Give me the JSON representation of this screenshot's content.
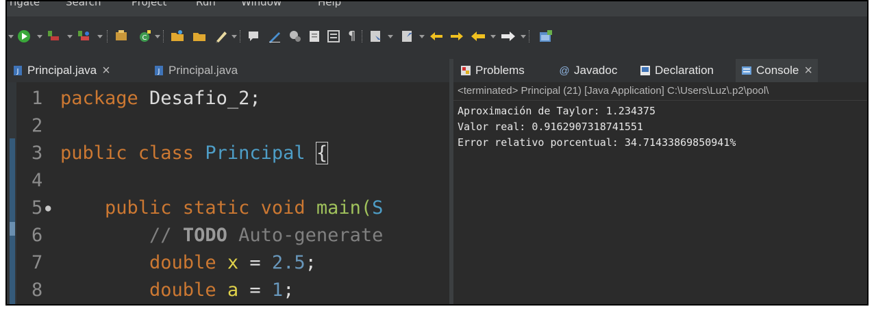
{
  "menubar": {
    "items": [
      "rigate",
      "Search",
      "Project",
      "Run",
      "Window",
      "Help"
    ]
  },
  "editor": {
    "tabs": [
      {
        "label": "Principal.java",
        "active": true,
        "close": "×"
      },
      {
        "label": "Principal.java",
        "active": false
      }
    ],
    "lines": [
      {
        "n": "1",
        "parts": [
          {
            "t": "package ",
            "c": "kw"
          },
          {
            "t": "Desafio_2;",
            "c": ""
          }
        ]
      },
      {
        "n": "2",
        "parts": []
      },
      {
        "n": "3",
        "parts": [
          {
            "t": "public class ",
            "c": "kw"
          },
          {
            "t": "Principal",
            "c": "cls"
          },
          {
            "t": " ",
            "c": ""
          }
        ],
        "brace": "{"
      },
      {
        "n": "4",
        "parts": []
      },
      {
        "n": "5",
        "marker": "●",
        "parts": [
          {
            "t": "    public static void ",
            "c": "kw"
          },
          {
            "t": "main(",
            "c": "fn"
          },
          {
            "t": "S",
            "c": "cls"
          }
        ]
      },
      {
        "n": "6",
        "parts": [
          {
            "t": "        // ",
            "c": "cmt"
          },
          {
            "t": "TODO",
            "c": "todo"
          },
          {
            "t": " Auto-generate",
            "c": "cmt"
          }
        ]
      },
      {
        "n": "7",
        "parts": [
          {
            "t": "        double ",
            "c": "kw"
          },
          {
            "t": "x",
            "c": "fld"
          },
          {
            "t": " = ",
            "c": ""
          },
          {
            "t": "2.5",
            "c": "num"
          },
          {
            "t": ";",
            "c": ""
          }
        ]
      },
      {
        "n": "8",
        "parts": [
          {
            "t": "        double ",
            "c": "kw"
          },
          {
            "t": "a",
            "c": "fld"
          },
          {
            "t": " = ",
            "c": ""
          },
          {
            "t": "1",
            "c": "num"
          },
          {
            "t": ";",
            "c": ""
          }
        ]
      }
    ]
  },
  "views": {
    "tabs": [
      {
        "label": "Problems",
        "icon": "problems-icon"
      },
      {
        "label": "Javadoc",
        "icon": "javadoc-icon"
      },
      {
        "label": "Declaration",
        "icon": "declaration-icon"
      },
      {
        "label": "Console",
        "icon": "console-icon",
        "active": true,
        "close": "×"
      }
    ]
  },
  "console": {
    "header": "<terminated> Principal (21) [Java Application] C:\\Users\\Luz\\.p2\\pool\\",
    "output": [
      "Aproximación de Taylor: 1.234375",
      "Valor real: 0.9162907318741551",
      "Error relativo porcentual: 34.71433869850941%"
    ]
  },
  "colors": {
    "background": "#2b2b2b",
    "keyword": "#cc7832",
    "class": "#4e9ec7",
    "field": "#e0d24a",
    "number": "#6897bb",
    "comment": "#808080"
  }
}
